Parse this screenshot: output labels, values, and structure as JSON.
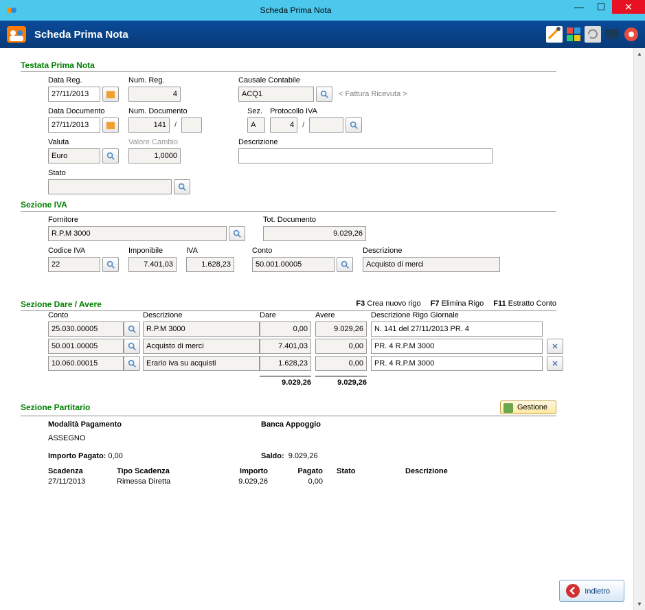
{
  "window": {
    "title": "Scheda Prima Nota"
  },
  "ribbon": {
    "title": "Scheda Prima Nota"
  },
  "testata": {
    "title": "Testata Prima Nota",
    "data_reg_label": "Data Reg.",
    "data_reg": "27/11/2013",
    "num_reg_label": "Num. Reg.",
    "num_reg": "4",
    "causale_label": "Causale Contabile",
    "causale": "ACQ1",
    "causale_hint": "< Fattura Ricevuta >",
    "data_doc_label": "Data Documento",
    "data_doc": "27/11/2013",
    "num_doc_label": "Num. Documento",
    "num_doc": "141",
    "num_doc_suffix": "",
    "sez_label": "Sez.",
    "sez": "A",
    "protocollo_label": "Protocollo IVA",
    "protocollo": "4",
    "protocollo_suffix": "",
    "valuta_label": "Valuta",
    "valuta": "Euro",
    "cambio_label": "Valore Cambio",
    "cambio": "1,0000",
    "descrizione_label": "Descrizione",
    "descrizione": "",
    "stato_label": "Stato",
    "stato": ""
  },
  "iva": {
    "title": "Sezione IVA",
    "fornitore_label": "Fornitore",
    "fornitore": "R.P.M 3000",
    "tot_doc_label": "Tot. Documento",
    "tot_doc": "9.029,26",
    "codice_label": "Codice IVA",
    "codice": "22",
    "imponibile_label": "Imponibile",
    "imponibile": "7.401,03",
    "iva_label": "IVA",
    "iva_val": "1.628,23",
    "conto_label": "Conto",
    "conto": "50.001.00005",
    "descrizione_label": "Descrizione",
    "descrizione": "Acquisto di merci"
  },
  "da": {
    "title": "Sezione Dare / Avere",
    "f3_key": "F3",
    "f3_txt": "Crea nuovo rigo",
    "f7_key": "F7",
    "f7_txt": "Elimina Rigo",
    "f11_key": "F11",
    "f11_txt": "Estratto Conto",
    "col_conto": "Conto",
    "col_descr": "Descrizione",
    "col_dare": "Dare",
    "col_avere": "Avere",
    "col_rigo": "Descrizione Rigo Giornale",
    "rows": [
      {
        "conto": "25.030.00005",
        "descr": "R.P.M 3000",
        "dare": "0,00",
        "avere": "9.029,26",
        "rigo": "N. 141 del 27/11/2013 PR. 4",
        "deletable": false
      },
      {
        "conto": "50.001.00005",
        "descr": "Acquisto di merci",
        "dare": "7.401,03",
        "avere": "0,00",
        "rigo": "PR. 4 R.P.M 3000",
        "deletable": true
      },
      {
        "conto": "10.060.00015",
        "descr": "Erario iva su acquisti",
        "dare": "1.628,23",
        "avere": "0,00",
        "rigo": "PR. 4 R.P.M 3000",
        "deletable": true
      }
    ],
    "total_dare": "9.029,26",
    "total_avere": "9.029,26"
  },
  "part": {
    "title": "Sezione Partitario",
    "gestione": "Gestione",
    "modalita_label": "Modalità Pagamento",
    "modalita": "ASSEGNO",
    "banca_label": "Banca Appoggio",
    "banca": "",
    "importo_pagato_label": "Importo Pagato:",
    "importo_pagato": "0,00",
    "saldo_label": "Saldo:",
    "saldo": "9.029,26",
    "cols": {
      "scadenza": "Scadenza",
      "tipo": "Tipo Scadenza",
      "importo": "Importo",
      "pagato": "Pagato",
      "stato": "Stato",
      "descr": "Descrizione"
    },
    "rows": [
      {
        "scadenza": "27/11/2013",
        "tipo": "Rimessa Diretta",
        "importo": "9.029,26",
        "pagato": "0,00",
        "stato": "",
        "descr": ""
      }
    ]
  },
  "footer": {
    "indietro": "Indietro"
  }
}
